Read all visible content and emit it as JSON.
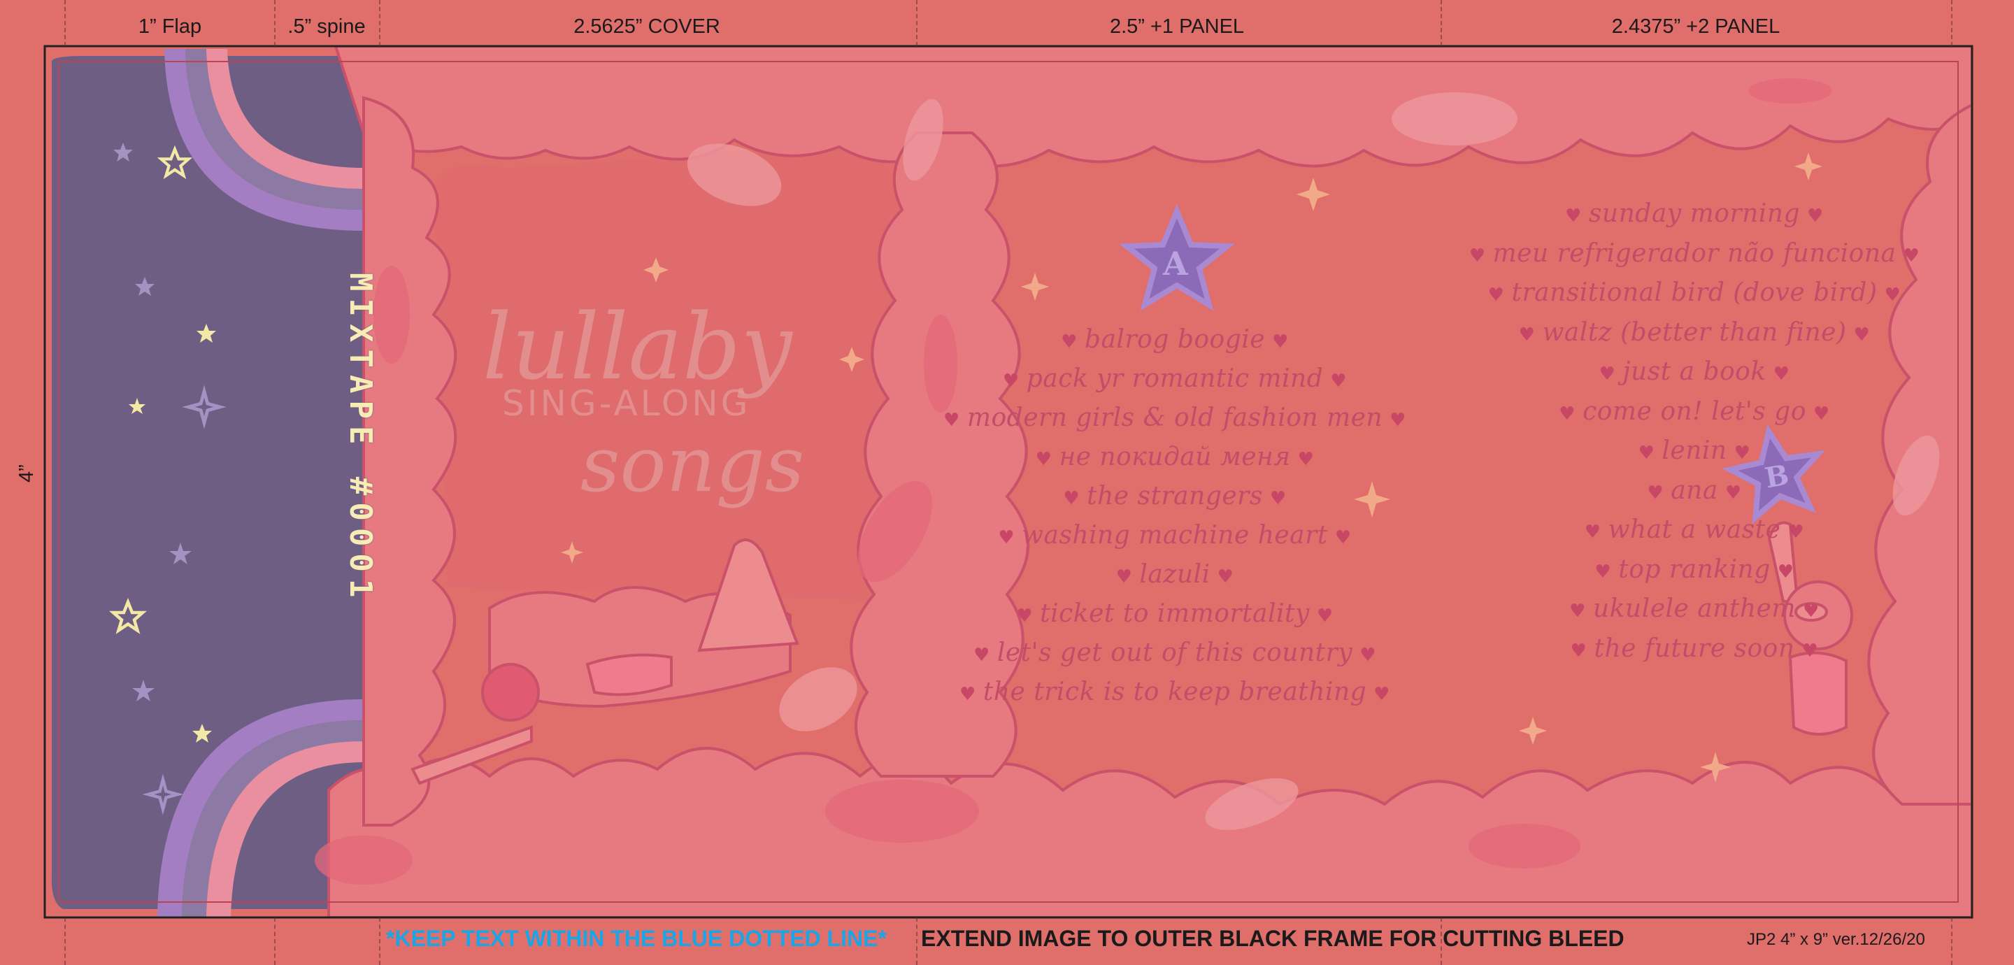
{
  "template_labels": {
    "flap": "1” Flap",
    "spine": ".5” spine",
    "cover": "2.5625” COVER",
    "panel1": "2.5” +1 PANEL",
    "panel2": "2.4375” +2 PANEL",
    "height": "4”"
  },
  "spine": {
    "title": "MIXTAPE #0001"
  },
  "cover": {
    "title_line1": "lullaby",
    "title_line2": "SING-ALONG",
    "title_line3": "songs"
  },
  "side_a": {
    "badge": "A",
    "tracks": [
      "balrog boogie",
      "pack yr romantic mind",
      "modern girls & old fashion men",
      "не покидай меня",
      "the strangers",
      "washing machine heart",
      "lazuli",
      "ticket to immortality",
      "let's get out of this country",
      "the trick is to keep breathing"
    ]
  },
  "side_b": {
    "badge": "B",
    "tracks": [
      "sunday morning",
      "meu refrigerador não funciona",
      "transitional bird (dove bird)",
      "waltz (better than fine)",
      "just a book",
      "come on! let's go",
      "lenin",
      "ana",
      "what a waste",
      "top ranking",
      "ukulele anthem",
      "the future soon"
    ]
  },
  "footer": {
    "keep_text": "*KEEP TEXT WITHIN THE BLUE DOTTED LINE*",
    "extend_text": "EXTEND IMAGE TO OUTER BLACK FRAME FOR CUTTING BLEED",
    "spec": "JP2  4” x 9”  ver.12/26/20"
  },
  "colors": {
    "background": "#e06e6a",
    "cloud": "#e67a80",
    "cloud_outline": "#c9526a",
    "night_sky": "#6f5e84",
    "rainbow_purple": "#a37ec2",
    "star_yellow": "#f3e9a6",
    "badge_purple": "#8b6bb8",
    "keep_text_blue": "#1aa6e6",
    "track_text": "#c34c69"
  },
  "icons": [
    "heart-icon",
    "star-icon",
    "sparkle-icon",
    "star-badge-icon"
  ]
}
